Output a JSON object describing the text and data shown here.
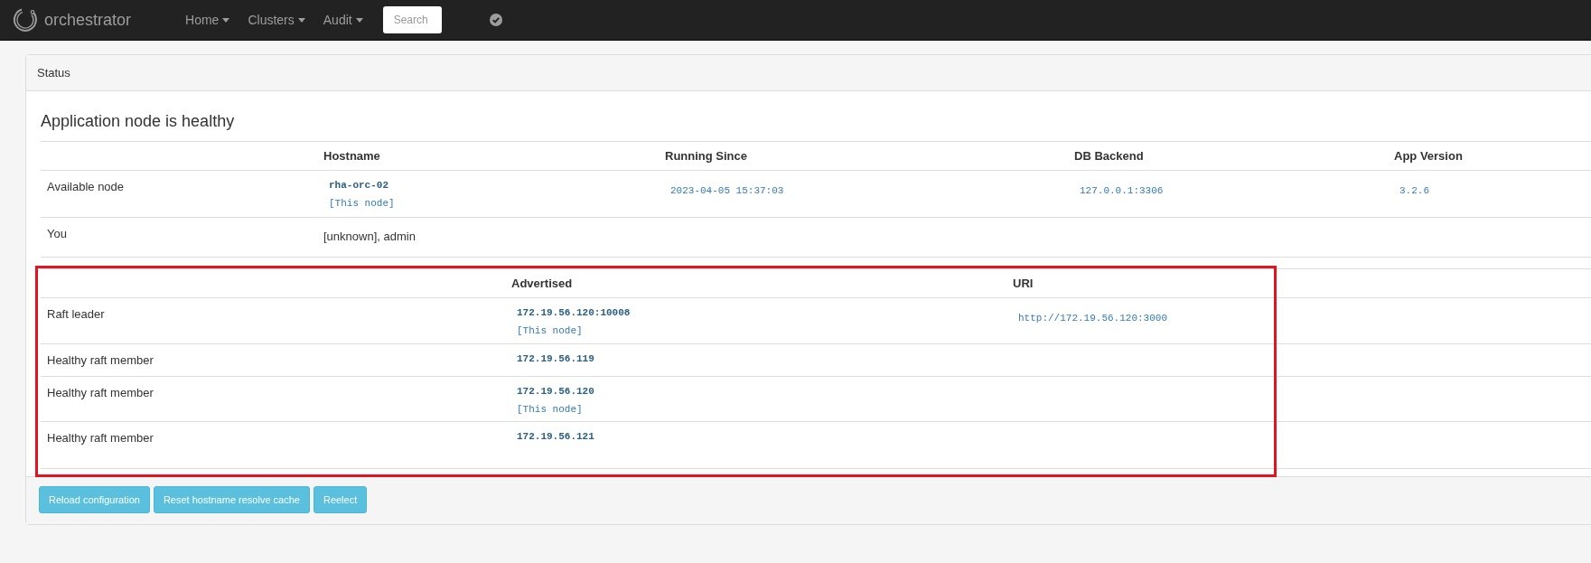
{
  "navbar": {
    "brand": "orchestrator",
    "menus": [
      {
        "label": "Home"
      },
      {
        "label": "Clusters"
      },
      {
        "label": "Audit"
      }
    ],
    "search": {
      "placeholder": "Search"
    }
  },
  "panel": {
    "title": "Status",
    "heading": "Application node is healthy",
    "node_table": {
      "columns": [
        "Hostname",
        "Running Since",
        "DB Backend",
        "App Version"
      ],
      "rows": [
        {
          "label": "Available node",
          "cells": [
            {
              "kind": "host",
              "value": "rha-orc-02",
              "note": "[This node]"
            },
            {
              "kind": "link",
              "value": "2023-04-05 15:37:03"
            },
            {
              "kind": "link",
              "value": "127.0.0.1:3306"
            },
            {
              "kind": "link",
              "value": "3.2.6"
            }
          ]
        },
        {
          "label": "You",
          "cells": [
            {
              "kind": "text",
              "value": "[unknown], admin"
            }
          ]
        }
      ]
    },
    "raft_table": {
      "highlighted": true,
      "columns": [
        "Advertised",
        "URI"
      ],
      "rows": [
        {
          "label": "Raft leader",
          "cells": [
            {
              "kind": "host",
              "value": "172.19.56.120:10008",
              "note": "[This node]"
            },
            {
              "kind": "link",
              "value": "http://172.19.56.120:3000"
            }
          ]
        },
        {
          "label": "Healthy raft member",
          "cells": [
            {
              "kind": "host",
              "value": "172.19.56.119"
            }
          ]
        },
        {
          "label": "Healthy raft member",
          "cells": [
            {
              "kind": "host",
              "value": "172.19.56.120",
              "note": "[This node]"
            }
          ]
        },
        {
          "label": "Healthy raft member",
          "cells": [
            {
              "kind": "host",
              "value": "172.19.56.121"
            }
          ]
        }
      ]
    },
    "buttons": [
      {
        "label": "Reload configuration"
      },
      {
        "label": "Reset hostname resolve cache"
      },
      {
        "label": "Reelect"
      }
    ]
  }
}
